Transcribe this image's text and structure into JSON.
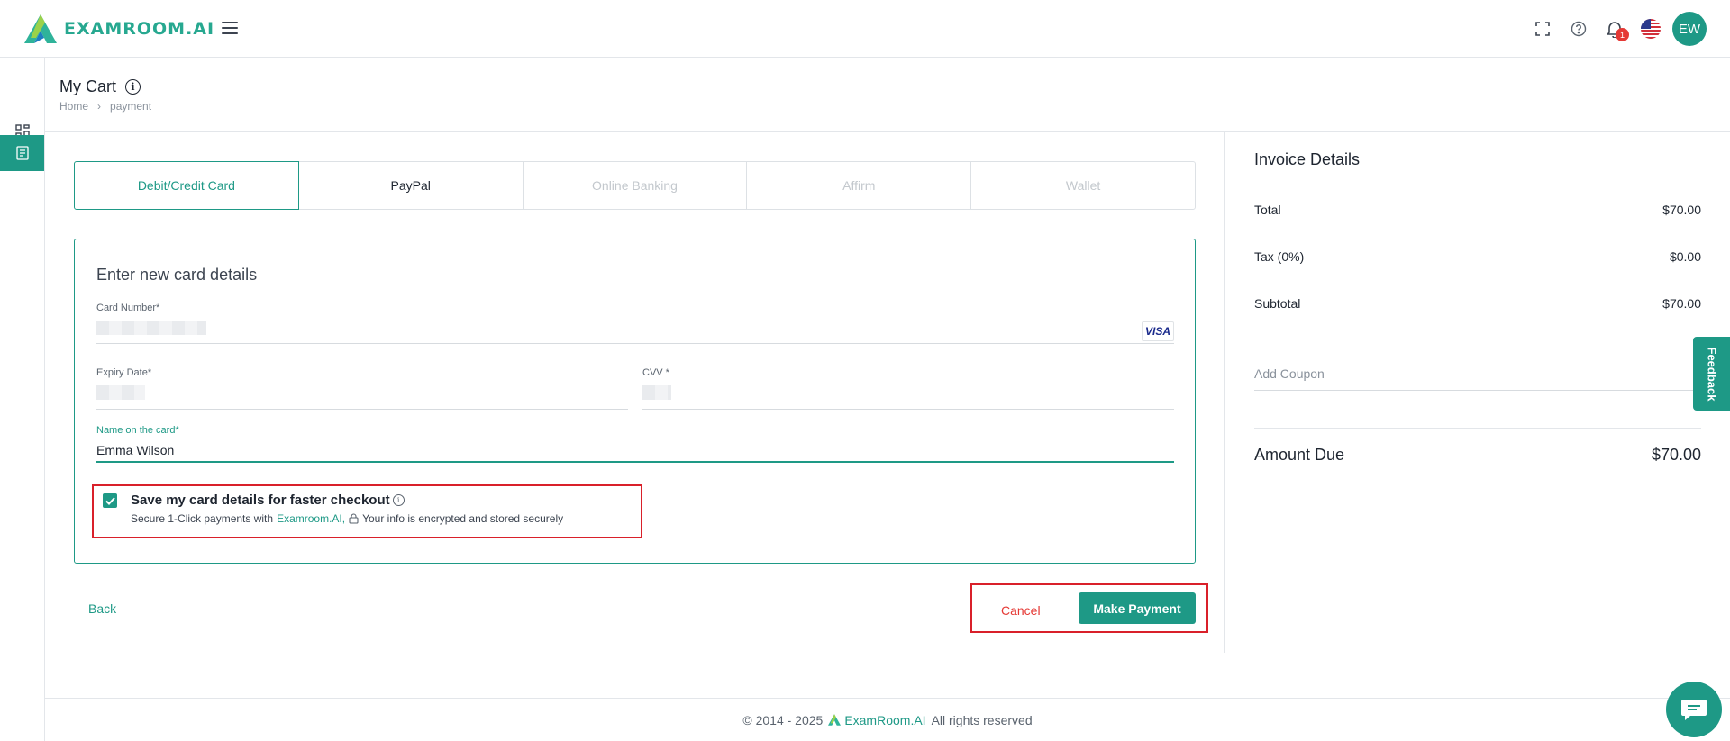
{
  "header": {
    "brand": "EXAMROOM.AI",
    "notification_count": "1",
    "avatar_initials": "EW"
  },
  "page": {
    "title": "My Cart",
    "breadcrumb": [
      "Home",
      "payment"
    ]
  },
  "payment_tabs": [
    {
      "label": "Debit/Credit Card",
      "state": "active"
    },
    {
      "label": "PayPal",
      "state": "enabled"
    },
    {
      "label": "Online Banking",
      "state": "disabled"
    },
    {
      "label": "Affirm",
      "state": "disabled"
    },
    {
      "label": "Wallet",
      "state": "disabled"
    }
  ],
  "card_form": {
    "title": "Enter new card details",
    "card_number_label": "Card Number*",
    "card_brand": "VISA",
    "expiry_label": "Expiry Date*",
    "cvv_label": "CVV *",
    "name_label": "Name on the card*",
    "name_value": "Emma Wilson",
    "save_title": "Save my card details for faster checkout",
    "save_sub_prefix": "Secure 1-Click payments with",
    "save_sub_brand": "Examroom.AI,",
    "save_sub_suffix": "Your info is encrypted and stored securely",
    "save_checked": true
  },
  "actions": {
    "back": "Back",
    "cancel": "Cancel",
    "pay": "Make Payment"
  },
  "invoice": {
    "title": "Invoice Details",
    "rows": [
      {
        "label": "Total",
        "value": "$70.00"
      },
      {
        "label": "Tax (0%)",
        "value": "$0.00"
      },
      {
        "label": "Subtotal",
        "value": "$70.00"
      }
    ],
    "coupon_placeholder": "Add Coupon",
    "amount_due_label": "Amount Due",
    "amount_due_value": "$70.00"
  },
  "feedback": "Feedback",
  "footer": {
    "copyright": "© 2014 - 2025",
    "brand": "ExamRoom.AI",
    "rights": "All rights reserved"
  },
  "colors": {
    "accent": "#1e9986",
    "highlight_border": "#d9202a",
    "cancel": "#e53935"
  }
}
